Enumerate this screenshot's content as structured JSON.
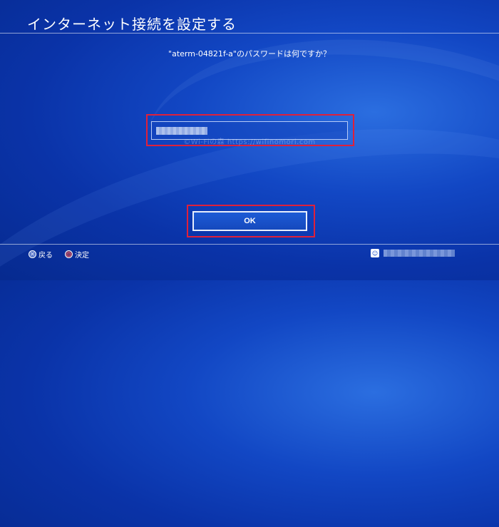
{
  "header": {
    "title": "インターネット接続を設定する"
  },
  "prompt": {
    "text": "\"aterm-04821f-a\"のパスワードは何ですか？"
  },
  "password_field": {
    "value_masked": true
  },
  "watermark": {
    "text": "©Wi-Fiの森 https://wifinomori.com"
  },
  "ok_button": {
    "label": "OK"
  },
  "footer": {
    "back_label": "戻る",
    "confirm_label": "決定",
    "back_icon": "cross-button-icon",
    "confirm_icon": "circle-button-icon",
    "user_icon": "avatar-icon"
  },
  "colors": {
    "background": "#0a33a8",
    "highlight": "#e0203a",
    "text": "#ffffff"
  }
}
